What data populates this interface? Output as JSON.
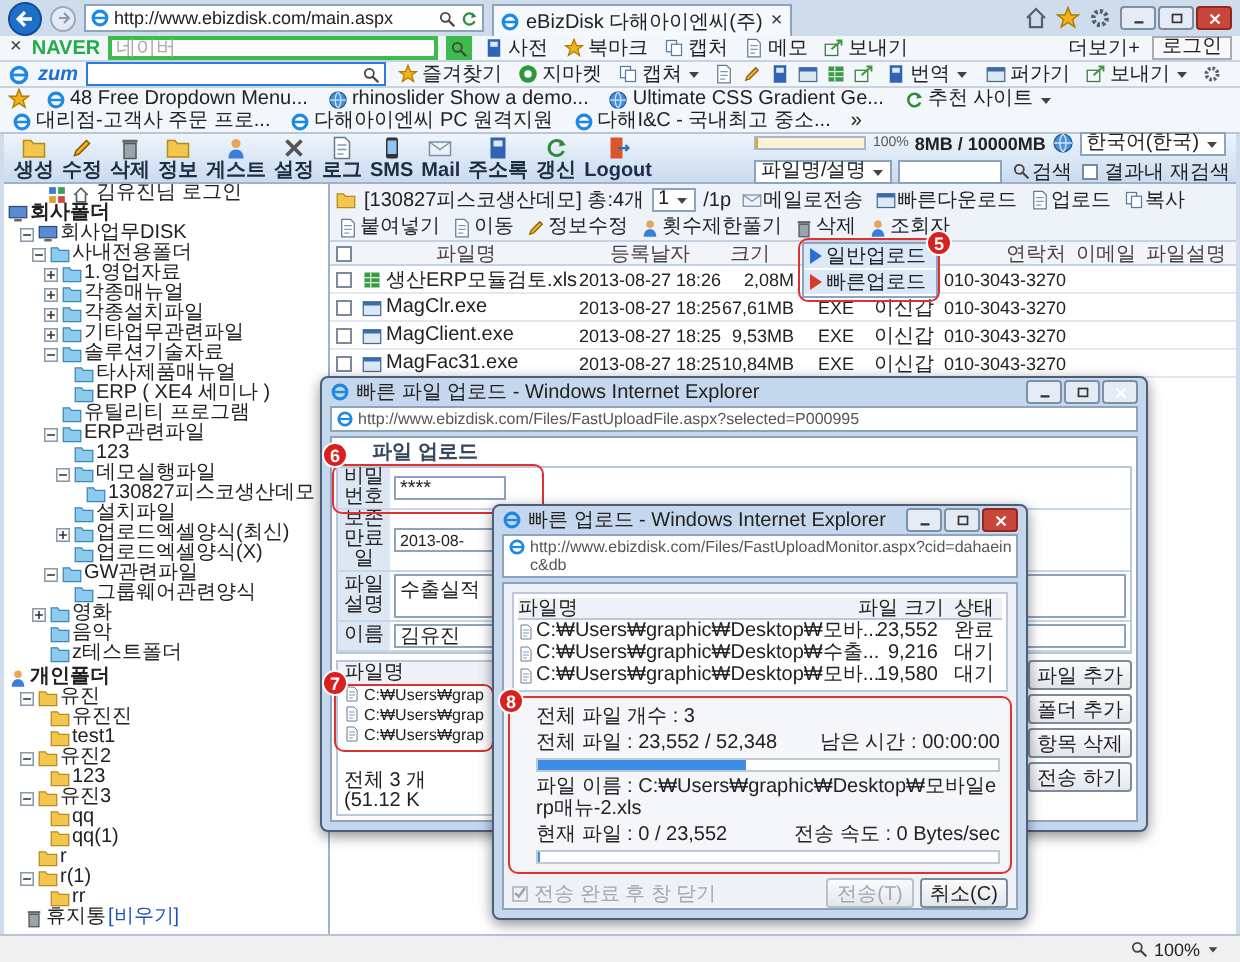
{
  "browser": {
    "address": "http://www.ebizdisk.com/main.aspx",
    "tab": {
      "title": "eBizDisk 다해아이엔씨(주)",
      "close": "×"
    },
    "naver_bar": {
      "close": "×",
      "logo": "NAVER",
      "placeholder": "네이버",
      "items": [
        "사전",
        "북마크",
        "캡처",
        "메모",
        "보내기"
      ],
      "more": "더보기+",
      "login": "로그인"
    },
    "zum_bar": {
      "logo": "zum",
      "items": [
        {
          "label": "즐겨찾기",
          "dropdown": false
        },
        {
          "label": "지마켓",
          "dropdown": false
        },
        {
          "label": "캡쳐",
          "dropdown": true
        }
      ],
      "items2": [
        {
          "label": "번역",
          "dropdown": true
        },
        {
          "label": "퍼가기",
          "dropdown": false
        },
        {
          "label": "보내기",
          "dropdown": true
        }
      ]
    },
    "favorites": [
      {
        "label": "48 Free Dropdown Menu...",
        "dropdown": false
      },
      {
        "label": "rhinoslider Show a demo...",
        "dropdown": false
      },
      {
        "label": "Ultimate CSS Gradient Ge...",
        "dropdown": false
      },
      {
        "label": "추천 사이트",
        "dropdown": true
      },
      {
        "label": "대리점-고객사 주문 프로...",
        "dropdown": false
      },
      {
        "label": "다해아이엔씨 PC 원격지원",
        "dropdown": false
      },
      {
        "label": "다해I&C - 국내최고 중소...",
        "dropdown": false
      }
    ],
    "favorites_more": "»"
  },
  "toolbar": [
    "생성",
    "수정",
    "삭제",
    "정보",
    "게스트",
    "설정",
    "로그",
    "SMS",
    "Mail",
    "주소록",
    "갱신",
    "Logout"
  ],
  "storage": {
    "level": 0.01,
    "scale": "100%",
    "usage": "8MB / 10000MB"
  },
  "language": "한국어(한국)",
  "search": {
    "scope": "파일명/설명",
    "button": "검색",
    "refine": {
      "label": "결과내 재검색",
      "checked": false
    }
  },
  "tree": {
    "header": "김유진님 로그인",
    "sections": [
      {
        "label": "회사폴더",
        "kind": "company",
        "children": [
          {
            "label": "회사업무DISK",
            "kind": "disk",
            "expanded": true,
            "children": [
              {
                "label": "사내전용폴더",
                "expanded": true,
                "children": [
                  {
                    "label": "1.영업자료",
                    "expanded": false
                  },
                  {
                    "label": "각종매뉴얼",
                    "expanded": false
                  },
                  {
                    "label": "각종설치파일",
                    "expanded": false
                  },
                  {
                    "label": "기타업무관련파일",
                    "expanded": false
                  },
                  {
                    "label": "솔루션기술자료",
                    "expanded": true,
                    "children": [
                      {
                        "label": "타사제품매뉴얼"
                      },
                      {
                        "label": "ERP ( XE4 세미나 )"
                      }
                    ]
                  },
                  {
                    "label": "유틸리티 프로그램"
                  },
                  {
                    "label": "ERP관련파일",
                    "expanded": true,
                    "children": [
                      {
                        "label": "123"
                      },
                      {
                        "label": "데모실행파일",
                        "expanded": true,
                        "children": [
                          {
                            "label": "130827피스코생산데모"
                          }
                        ]
                      },
                      {
                        "label": "설치파일"
                      },
                      {
                        "label": "업로드엑셀양식(최신)",
                        "expanded": false
                      },
                      {
                        "label": "업로드엑셀양식(X)"
                      }
                    ]
                  },
                  {
                    "label": "GW관련파일",
                    "expanded": true,
                    "children": [
                      {
                        "label": "그룹웨어관련양식"
                      }
                    ]
                  }
                ]
              },
              {
                "label": "영화",
                "expanded": false
              },
              {
                "label": "음악"
              },
              {
                "label": "z테스트폴더"
              }
            ]
          }
        ]
      },
      {
        "label": "개인폴더",
        "kind": "personal",
        "children": [
          {
            "label": "유진",
            "expanded": true,
            "children": [
              {
                "label": "유진진"
              },
              {
                "label": "test1"
              }
            ]
          },
          {
            "label": "유진2",
            "expanded": true,
            "children": [
              {
                "label": "123"
              }
            ]
          },
          {
            "label": "유진3",
            "expanded": true,
            "children": [
              {
                "label": "qq"
              },
              {
                "label": "qq(1)"
              }
            ]
          },
          {
            "label": "r"
          },
          {
            "label": "r(1)",
            "expanded": true,
            "children": [
              {
                "label": "rr"
              }
            ]
          }
        ]
      }
    ],
    "trash": {
      "label": "휴지통",
      "action": "[비우기]"
    }
  },
  "path": "[130827피스코생산데모] 총:4개",
  "page": {
    "value": "1",
    "suffix": "/1p"
  },
  "actions": [
    "메일로전송",
    "빠른다운로드",
    "업로드",
    "복사",
    "붙여넣기",
    "이동",
    "정보수정",
    "횟수제한풀기",
    "삭제",
    "조회자"
  ],
  "upload_menu": {
    "items": [
      {
        "label": "일반업로드",
        "color": "#2a6fd6"
      },
      {
        "label": "빠른업로드",
        "color": "#d83a2a"
      }
    ]
  },
  "files": {
    "select_all": {
      "checked": false
    },
    "columns": {
      "name": "파일명",
      "date": "등록날자",
      "size": "크기",
      "contact": "연락처",
      "email": "이메일",
      "description": "파일설명"
    },
    "rows": [
      {
        "checked": false,
        "kind": "spreadsheet",
        "name": "생산ERP모듈검토.xls",
        "date": "2013-08-27 18:26",
        "size": "2,08M",
        "contact": "010-3043-3270"
      },
      {
        "checked": false,
        "kind": "program",
        "name": "MagClr.exe",
        "date": "2013-08-27 18:25",
        "size": "67,61MB",
        "type": "EXE",
        "owner": "이신갑",
        "contact": "010-3043-3270"
      },
      {
        "checked": false,
        "kind": "program",
        "name": "MagClient.exe",
        "date": "2013-08-27 18:25",
        "size": "9,53MB",
        "type": "EXE",
        "owner": "이신갑",
        "contact": "010-3043-3270"
      },
      {
        "checked": false,
        "kind": "program",
        "name": "MagFac31.exe",
        "date": "2013-08-27 18:25",
        "size": "10,84MB",
        "type": "EXE",
        "owner": "이신갑",
        "contact": "010-3043-3270"
      }
    ]
  },
  "upload_dialog": {
    "title": "빠른 파일 업로드 - Windows Internet Explorer",
    "url": "http://www.ebizdisk.com/Files/FastUploadFile.aspx?selected=P000995",
    "heading": "파일 업로드",
    "fields": [
      {
        "label": "비밀번호",
        "value": "****",
        "kind": "password"
      },
      {
        "label": "보존만료일",
        "value": "2013-08-",
        "kind": "date"
      },
      {
        "label": "파일설명",
        "value": "수출실적",
        "kind": "textarea"
      },
      {
        "label": "이름",
        "value": "김유진",
        "kind": "text"
      }
    ],
    "list_header": "파일명",
    "list": [
      "C:₩Users₩grap",
      "C:₩Users₩grap",
      "C:₩Users₩grap"
    ],
    "total": "전체 3 개 (51.12 K",
    "buttons": [
      "파일 추가",
      "폴더 추가",
      "항목 삭제",
      "전송 하기"
    ]
  },
  "monitor": {
    "title": "빠른 업로드 - Windows Internet Explorer",
    "url": "http://www.ebizdisk.com/Files/FastUploadMonitor.aspx?cid=dahaeinc&db",
    "columns": [
      "파일명",
      "파일 크기",
      "상태"
    ],
    "rows": [
      {
        "name": "C:₩Users₩graphic₩Desktop₩모바...",
        "size": "23,552",
        "status": "완료"
      },
      {
        "name": "C:₩Users₩graphic₩Desktop₩수출...",
        "size": "9,216",
        "status": "대기"
      },
      {
        "name": "C:₩Users₩graphic₩Desktop₩모바...",
        "size": "19,580",
        "status": "대기"
      }
    ],
    "file_count": "전체 파일 개수 : 3",
    "total": "전체 파일 : 23,552 / 52,348",
    "remaining": "남은 시간 : 00:00:00",
    "total_progress": {
      "level": 0.45
    },
    "file_name": "파일 이름 : C:₩Users₩graphic₩Desktop₩모바일erp매뉴-2.xls",
    "current": "현재 파일 : 0 / 23,552",
    "speed": "전송 속도 : 0 Bytes/sec",
    "file_progress": {
      "level": 0
    },
    "close_after": {
      "label": "전송 완료 후 창 닫기",
      "checked": true,
      "disabled": true
    },
    "buttons": [
      {
        "label": "전송(T)",
        "disabled": true
      },
      {
        "label": "취소(C)",
        "disabled": false
      }
    ]
  },
  "callouts": [
    "5",
    "6",
    "7",
    "8"
  ],
  "zoom": "100%"
}
